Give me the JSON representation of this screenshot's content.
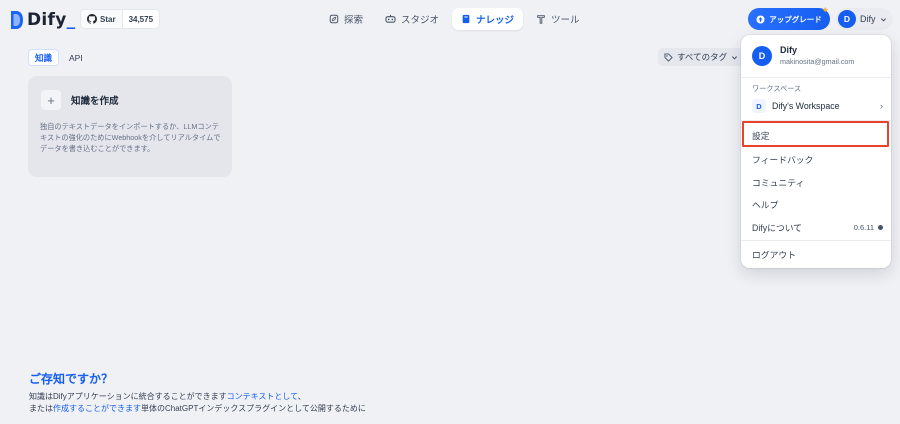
{
  "brand": {
    "name": "Dify",
    "suffix": "_",
    "accent": "#155eef"
  },
  "github": {
    "label": "Star",
    "count": "34,575"
  },
  "nav": [
    {
      "label": "探索",
      "icon": "explore-icon"
    },
    {
      "label": "スタジオ",
      "icon": "studio-icon"
    },
    {
      "label": "ナレッジ",
      "icon": "book-icon",
      "active": true
    },
    {
      "label": "ツール",
      "icon": "tool-icon"
    }
  ],
  "upgrade": {
    "label": "アップグレード"
  },
  "user": {
    "initial": "D",
    "name": "Dify",
    "email": "makinosita@gmail.com"
  },
  "tabs": [
    {
      "label": "知識",
      "active": true
    },
    {
      "label": "API"
    }
  ],
  "tag_filter": {
    "label": "すべてのタグ"
  },
  "create_card": {
    "title": "知識を作成",
    "description": "独自のテキストデータをインポートするか、LLMコンテキストの強化のためにWebhookを介してリアルタイムでデータを書き込むことができます。"
  },
  "did_you_know": {
    "title": "ご存知ですか？",
    "line1_prefix": "知識はDifyアプリケーションに統合することができます",
    "line1_link": "コンテキストとして",
    "line1_suffix": "、",
    "line2_prefix": "または",
    "line2_link": "作成することができます",
    "line2_suffix": "単体のChatGPTインデックスプラグインとして公開するために"
  },
  "menu": {
    "workspace_label": "ワークスペース",
    "workspace_initial": "D",
    "workspace_name": "Dify's Workspace",
    "items": {
      "settings": "設定",
      "feedback": "フィードバック",
      "community": "コミュニティ",
      "help": "ヘルプ",
      "about": "Difyについて",
      "version": "0.6.11",
      "logout": "ログアウト"
    }
  }
}
